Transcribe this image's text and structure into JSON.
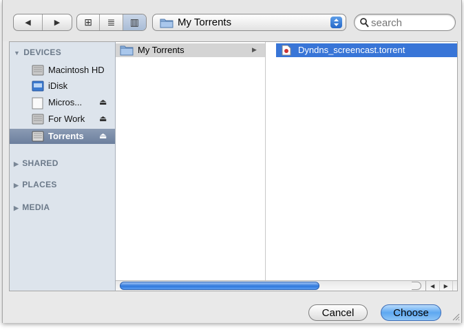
{
  "toolbar": {
    "back_glyph": "◀",
    "forward_glyph": "▶",
    "view_icon_glyph": "⊞",
    "view_list_glyph": "≣",
    "view_column_glyph": "▥",
    "path_label": "My Torrents",
    "search_placeholder": "search"
  },
  "sidebar": {
    "devices_header": "DEVICES",
    "devices": [
      {
        "label": "Macintosh HD",
        "icon": "hard-drive-icon"
      },
      {
        "label": "iDisk",
        "icon": "idisk-icon"
      },
      {
        "label": "Micros...",
        "icon": "document-drive-icon",
        "eject": "⏏"
      },
      {
        "label": "For Work",
        "icon": "hard-drive-icon",
        "eject": "⏏"
      },
      {
        "label": "Torrents",
        "icon": "hard-drive-icon",
        "eject": "⏏",
        "selected": true
      }
    ],
    "sections": [
      "SHARED",
      "PLACES",
      "MEDIA"
    ],
    "expanded_glyph": "▼",
    "collapsed_glyph": "▶"
  },
  "columns": {
    "col1_item": "My Torrents",
    "col1_arrow": "▶",
    "col1_resize": "II",
    "col2_item": "Dyndns_screencast.torrent"
  },
  "scrollbar": {
    "left_glyph": "◀",
    "right_glyph": "▶"
  },
  "buttons": {
    "cancel": "Cancel",
    "choose": "Choose"
  },
  "colors": {
    "selection_blue": "#3875d7",
    "sidebar_bg": "#dde4ec",
    "sidebar_header": "#6b7989"
  }
}
